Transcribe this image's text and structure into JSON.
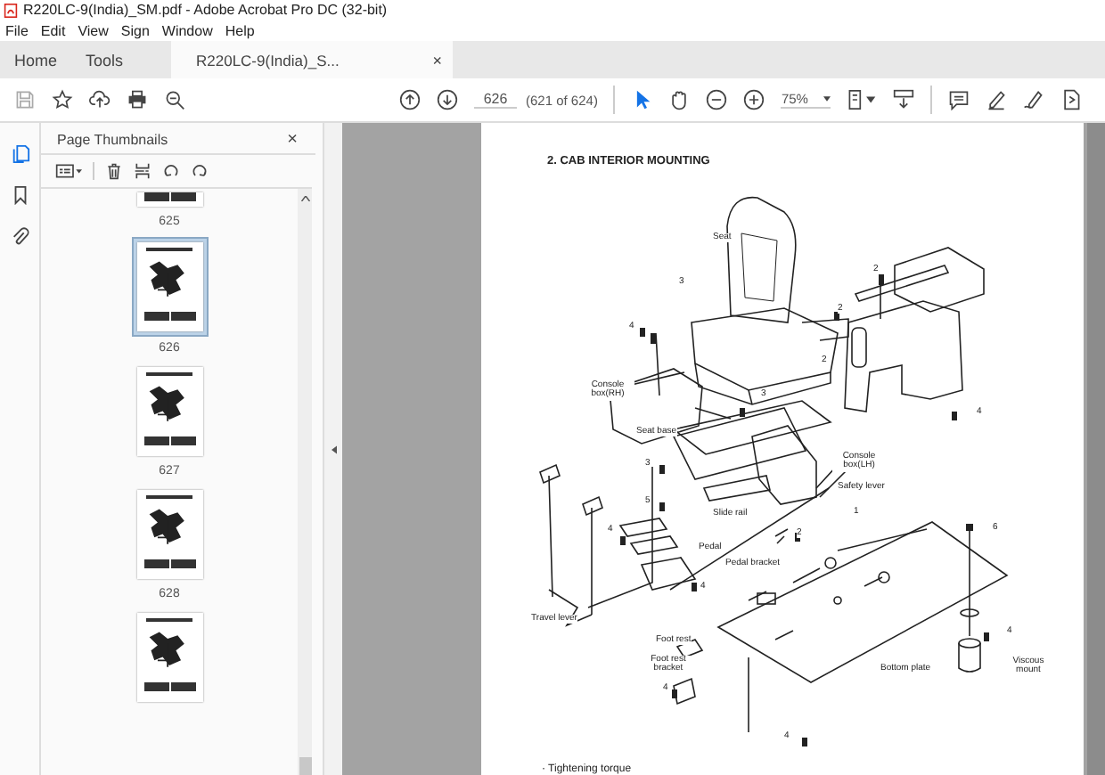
{
  "window": {
    "title": "R220LC-9(India)_SM.pdf - Adobe Acrobat Pro DC (32-bit)"
  },
  "menu": [
    "File",
    "Edit",
    "View",
    "Sign",
    "Window",
    "Help"
  ],
  "tabs": [
    {
      "label": "Home",
      "kind": "nav",
      "selected": false
    },
    {
      "label": "Tools",
      "kind": "nav",
      "selected": false
    },
    {
      "label": "R220LC-9(India)_S...",
      "kind": "document",
      "selected": true,
      "close": "×"
    }
  ],
  "toolbar": {
    "page_number": "626",
    "page_count": "(621 of 624)",
    "zoom": "75%"
  },
  "thumbnails_panel": {
    "title": "Page Thumbnails",
    "close": "×",
    "thumbnails": [
      {
        "label": "625",
        "selected": false,
        "partial": true
      },
      {
        "label": "626",
        "selected": true,
        "partial": false
      },
      {
        "label": "627",
        "selected": false,
        "partial": false
      },
      {
        "label": "628",
        "selected": false,
        "partial": false
      },
      {
        "selected": false,
        "partial": false
      }
    ]
  },
  "document": {
    "heading": "2. CAB INTERIOR MOUNTING",
    "labels": [
      {
        "text": "Seat",
        "kind": "name"
      },
      {
        "text": "3",
        "kind": "callout"
      },
      {
        "text": "2",
        "kind": "callout"
      },
      {
        "text": "4",
        "kind": "callout"
      },
      {
        "text": "2",
        "kind": "callout"
      },
      {
        "text": "2",
        "kind": "callout"
      },
      {
        "text": "3",
        "kind": "callout"
      },
      {
        "text": "4",
        "kind": "callout"
      },
      {
        "text": "Console box(RH)",
        "kind": "name"
      },
      {
        "text": "Seat base",
        "kind": "name"
      },
      {
        "text": "Console box(LH)",
        "kind": "name"
      },
      {
        "text": "Safety lever",
        "kind": "name"
      },
      {
        "text": "3",
        "kind": "callout"
      },
      {
        "text": "5",
        "kind": "callout"
      },
      {
        "text": "1",
        "kind": "callout"
      },
      {
        "text": "Slide rail",
        "kind": "name"
      },
      {
        "text": "2",
        "kind": "callout"
      },
      {
        "text": "6",
        "kind": "callout"
      },
      {
        "text": "4",
        "kind": "callout"
      },
      {
        "text": "Pedal",
        "kind": "name"
      },
      {
        "text": "Pedal bracket",
        "kind": "name"
      },
      {
        "text": "4",
        "kind": "callout"
      },
      {
        "text": "Travel lever",
        "kind": "name"
      },
      {
        "text": "4",
        "kind": "callout"
      },
      {
        "text": "Foot rest",
        "kind": "name"
      },
      {
        "text": "Foot rest bracket",
        "kind": "name"
      },
      {
        "text": "Bottom plate",
        "kind": "name"
      },
      {
        "text": "Viscous mount",
        "kind": "name"
      },
      {
        "text": "4",
        "kind": "callout"
      },
      {
        "text": "4",
        "kind": "callout"
      }
    ],
    "footnote": "· Tightening torque"
  }
}
